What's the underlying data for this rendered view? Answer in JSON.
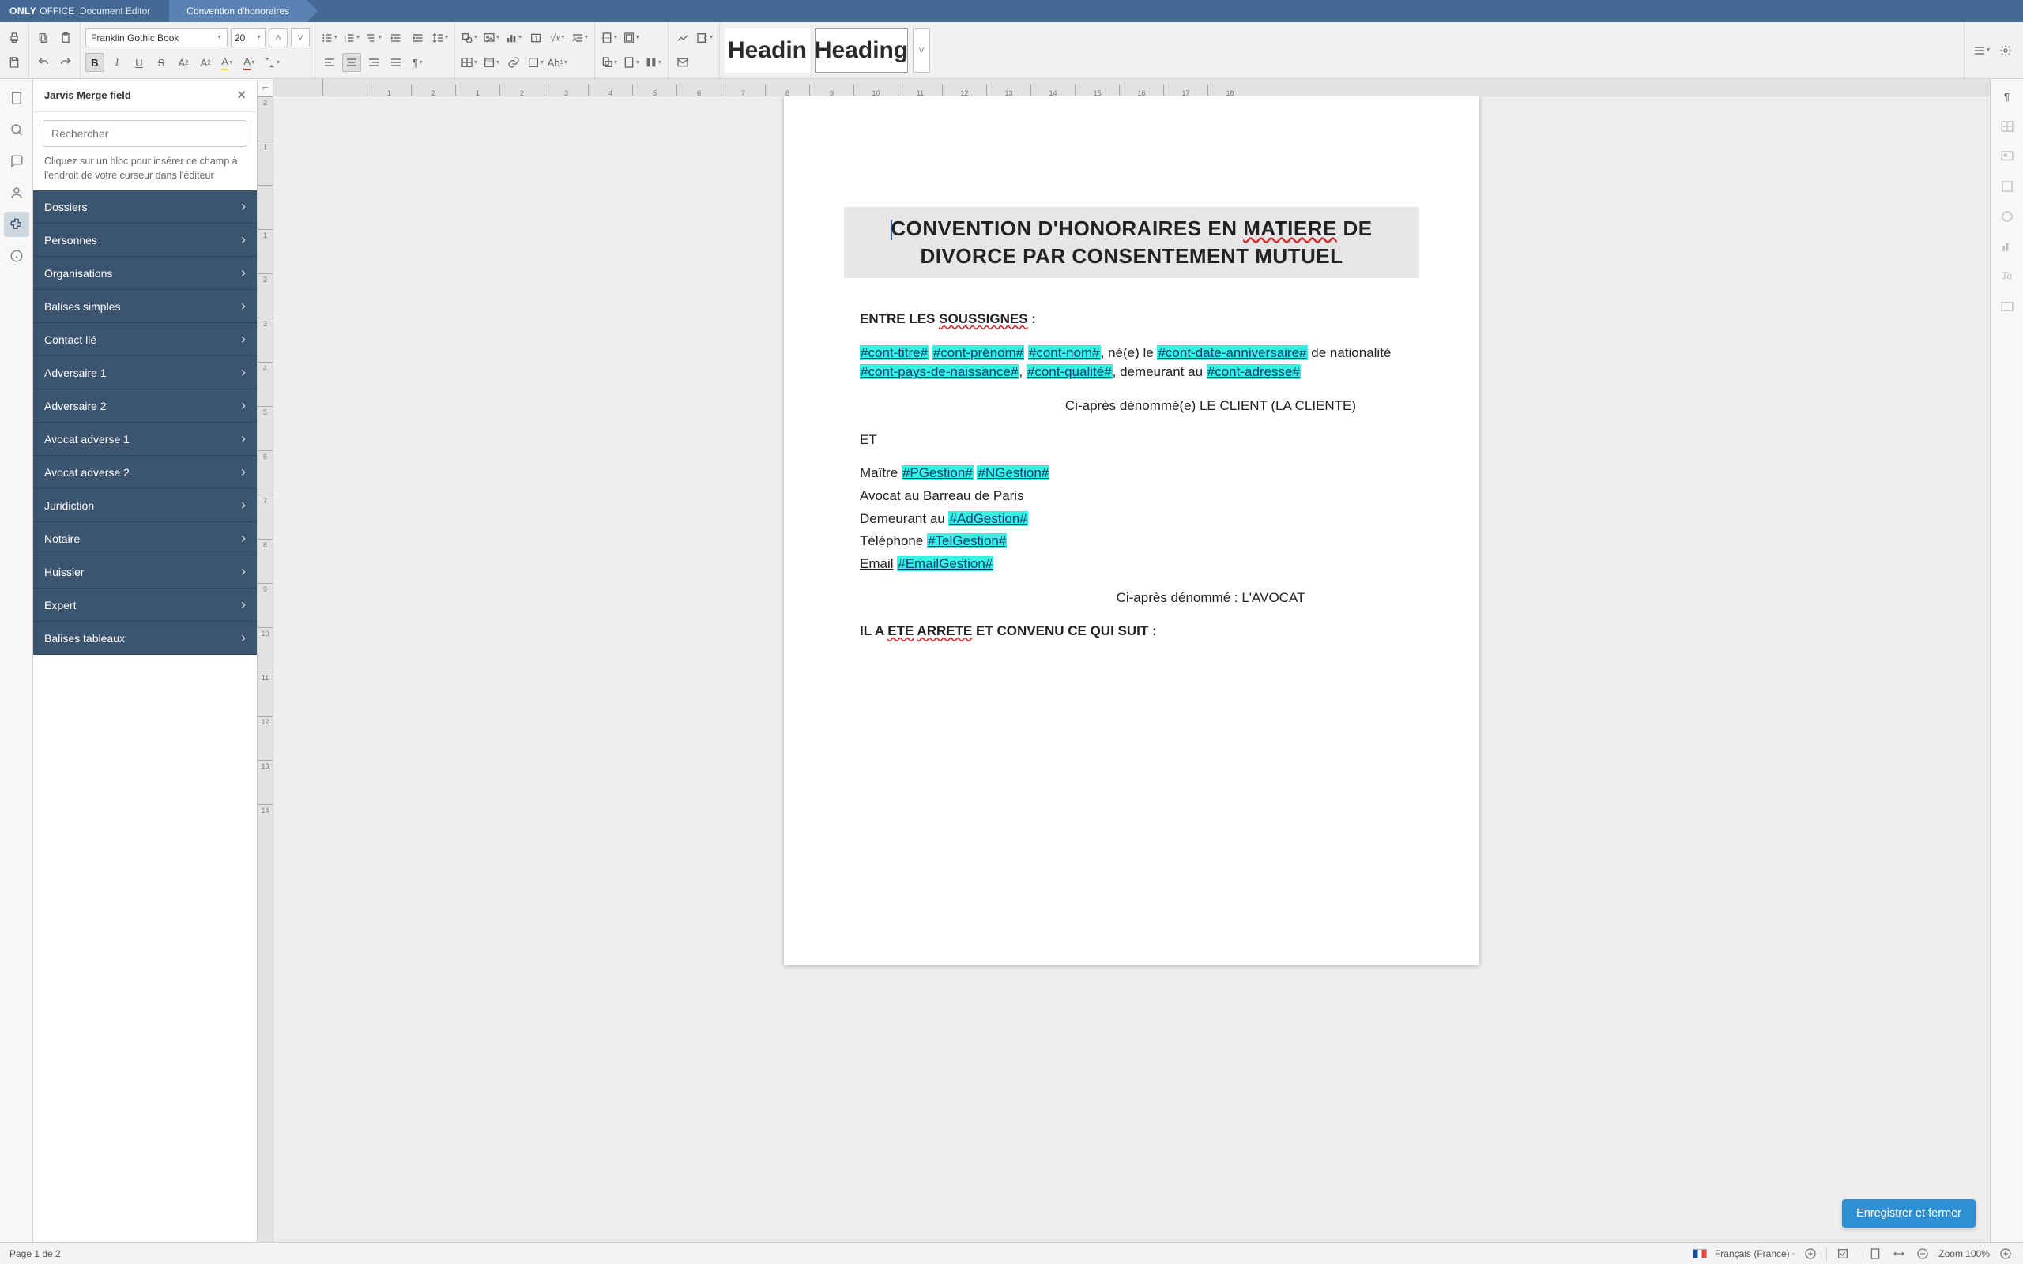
{
  "app": {
    "brand_bold": "ONLY",
    "brand_light": "OFFICE",
    "editor_label": "Document Editor",
    "doc_title": "Convention d'honoraires"
  },
  "toolbar": {
    "font_name": "Franklin Gothic Book",
    "font_size": "20",
    "style_presets": [
      "Headin",
      "Heading"
    ],
    "selected_style_index": 1
  },
  "sidepanel": {
    "title": "Jarvis Merge field",
    "search_placeholder": "Rechercher",
    "hint": "Cliquez sur un bloc pour insérer ce champ à l'endroit de votre curseur dans l'éditeur",
    "items": [
      "Dossiers",
      "Personnes",
      "Organisations",
      "Balises simples",
      "Contact lié",
      "Adversaire 1",
      "Adversaire 2",
      "Avocat adverse 1",
      "Avocat adverse 2",
      "Juridiction",
      "Notaire",
      "Huissier",
      "Expert",
      "Balises tableaux"
    ]
  },
  "document": {
    "title_line1_a": "CONVENTION D'HONORAIRES EN ",
    "title_line1_b": "MATIERE",
    "title_line1_c": " DE",
    "title_line2": "DIVORCE PAR CONSENTEMENT MUTUEL",
    "p_entre_a": "ENTRE LES ",
    "p_entre_b": "SOUSSIGNES",
    "p_entre_c": " :",
    "mf_cont_titre": "#cont-titre#",
    "mf_cont_prenom": "#cont-prénom#",
    "mf_cont_nom": "#cont-nom#",
    "txt_ne_le": ", né(e) le ",
    "mf_cont_date": "#cont-date-anniversaire#",
    "txt_de_nat": " de nationalité ",
    "mf_cont_pays": "#cont-pays-de-naissance#",
    "txt_comma": ", ",
    "mf_cont_qualite": "#cont-qualité#",
    "txt_demeurant": ", demeurant au ",
    "mf_cont_adresse": "#cont-adresse#",
    "p_ci_apres_client": "Ci-après dénommé(e) LE CLIENT (LA CLIENTE)",
    "p_et": "ET",
    "p_maitre": "Maître ",
    "mf_pgestion": "#PGestion#",
    "mf_ngestion": "#NGestion#",
    "p_barreau": "Avocat au Barreau de Paris",
    "p_demeurant": "Demeurant au ",
    "mf_adgestion": "#AdGestion#",
    "p_telephone": "Téléphone ",
    "mf_telgestion": "#TelGestion#",
    "p_email": "Email",
    "mf_emailgestion": "#EmailGestion#",
    "p_ci_apres_avocat": "Ci-après dénommé : L'AVOCAT",
    "p_arrete_a": "IL A ",
    "p_arrete_b": "ETE",
    "p_arrete_c": " ",
    "p_arrete_d": "ARRETE",
    "p_arrete_e": " ET CONVENU CE QUI SUIT :"
  },
  "floating_button": {
    "label": "Enregistrer et fermer"
  },
  "statusbar": {
    "page_info": "Page 1 de 2",
    "language": "Français (France)",
    "zoom": "Zoom 100%"
  },
  "ruler": {
    "h": [
      "",
      "1",
      "2",
      "1",
      "2",
      "3",
      "4",
      "5",
      "6",
      "7",
      "8",
      "9",
      "10",
      "11",
      "12",
      "13",
      "14",
      "15",
      "16",
      "17",
      "18"
    ],
    "v": [
      "2",
      "1",
      "",
      "1",
      "2",
      "3",
      "4",
      "5",
      "6",
      "7",
      "8",
      "9",
      "10",
      "11",
      "12",
      "13",
      "14"
    ]
  }
}
